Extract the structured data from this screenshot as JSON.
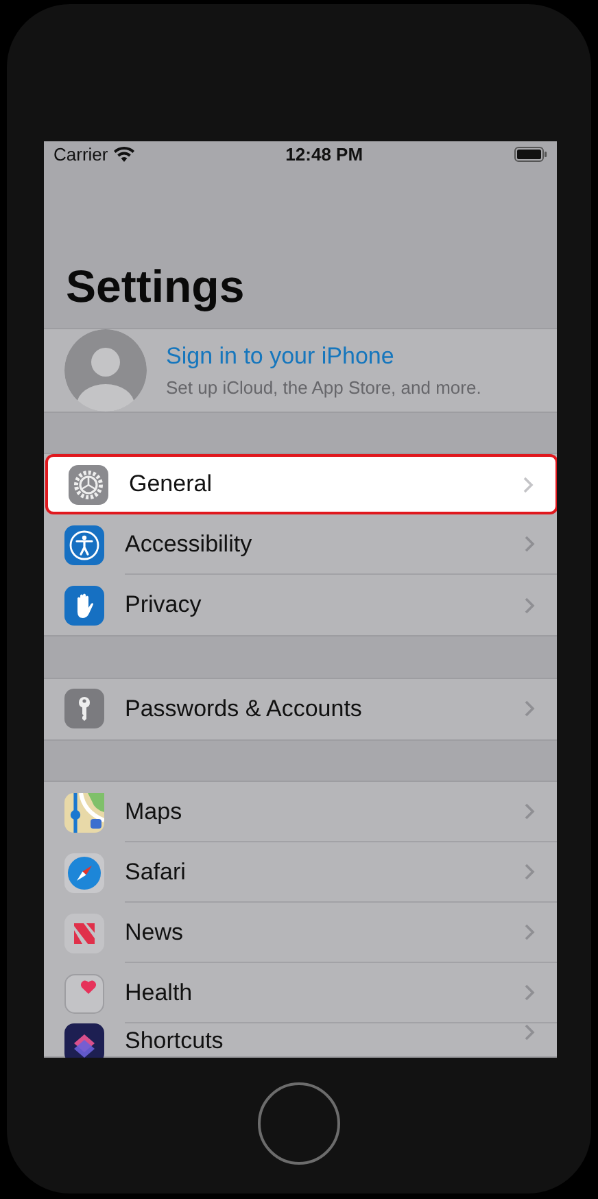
{
  "status_bar": {
    "carrier": "Carrier",
    "time": "12:48 PM"
  },
  "title": "Settings",
  "profile": {
    "name": "Sign in to your iPhone",
    "subtitle": "Set up iCloud, the App Store, and more."
  },
  "groups": [
    [
      {
        "label": "General",
        "kind": "gear",
        "selected": true
      },
      {
        "label": "Accessibility",
        "kind": "accessibility",
        "selected": false
      },
      {
        "label": "Privacy",
        "kind": "hand",
        "selected": false
      }
    ],
    [
      {
        "label": "Passwords & Accounts",
        "kind": "key",
        "selected": false
      }
    ],
    [
      {
        "label": "Maps",
        "kind": "map",
        "selected": false
      },
      {
        "label": "Safari",
        "kind": "compass",
        "selected": false
      },
      {
        "label": "News",
        "kind": "news",
        "selected": false
      },
      {
        "label": "Health",
        "kind": "heart",
        "selected": false
      },
      {
        "label": "Shortcuts",
        "kind": "shortcuts",
        "selected": false
      }
    ]
  ]
}
